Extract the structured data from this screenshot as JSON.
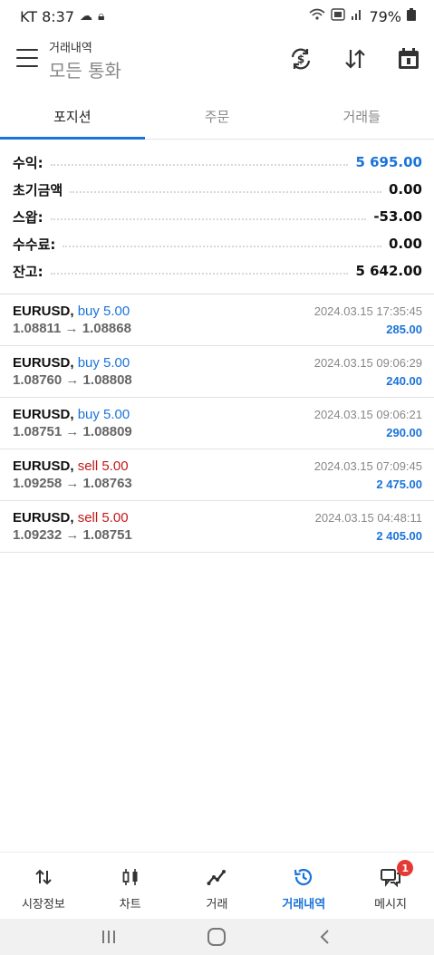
{
  "status_bar": {
    "carrier_time": "KT 8:37",
    "battery": "79%"
  },
  "header": {
    "subtitle": "거래내역",
    "title": "모든 통화"
  },
  "tabs": [
    {
      "label": "포지션",
      "active": true
    },
    {
      "label": "주문",
      "active": false
    },
    {
      "label": "거래들",
      "active": false
    }
  ],
  "summary": [
    {
      "label": "수익:",
      "value": "5 695.00",
      "color": "#1a73d9"
    },
    {
      "label": "초기금액",
      "value": "0.00"
    },
    {
      "label": "스왑:",
      "value": "-53.00"
    },
    {
      "label": "수수료:",
      "value": "0.00"
    },
    {
      "label": "잔고:",
      "value": "5 642.00"
    }
  ],
  "deals": [
    {
      "symbol": "EURUSD,",
      "direction": "buy 5.00",
      "type": "buy",
      "prices": "1.08811 → 1.08868",
      "time": "2024.03.15 17:35:45",
      "profit": "285.00"
    },
    {
      "symbol": "EURUSD,",
      "direction": "buy 5.00",
      "type": "buy",
      "prices": "1.08760 → 1.08808",
      "time": "2024.03.15 09:06:29",
      "profit": "240.00"
    },
    {
      "symbol": "EURUSD,",
      "direction": "buy 5.00",
      "type": "buy",
      "prices": "1.08751 → 1.08809",
      "time": "2024.03.15 09:06:21",
      "profit": "290.00"
    },
    {
      "symbol": "EURUSD,",
      "direction": "sell 5.00",
      "type": "sell",
      "prices": "1.09258 → 1.08763",
      "time": "2024.03.15 07:09:45",
      "profit": "2 475.00"
    },
    {
      "symbol": "EURUSD,",
      "direction": "sell 5.00",
      "type": "sell",
      "prices": "1.09232 → 1.08751",
      "time": "2024.03.15 04:48:11",
      "profit": "2 405.00"
    }
  ],
  "bottom_nav": [
    {
      "label": "시장정보",
      "icon": "quotes-arrows-icon",
      "active": false
    },
    {
      "label": "차트",
      "icon": "candlestick-icon",
      "active": false
    },
    {
      "label": "거래",
      "icon": "trade-line-icon",
      "active": false
    },
    {
      "label": "거래내역",
      "icon": "history-clock-icon",
      "active": true
    },
    {
      "label": "메시지",
      "icon": "messages-icon",
      "active": false,
      "badge": "1"
    }
  ],
  "colors": {
    "accent": "#1a73d9",
    "sell": "#c21818",
    "badge": "#e53935"
  }
}
